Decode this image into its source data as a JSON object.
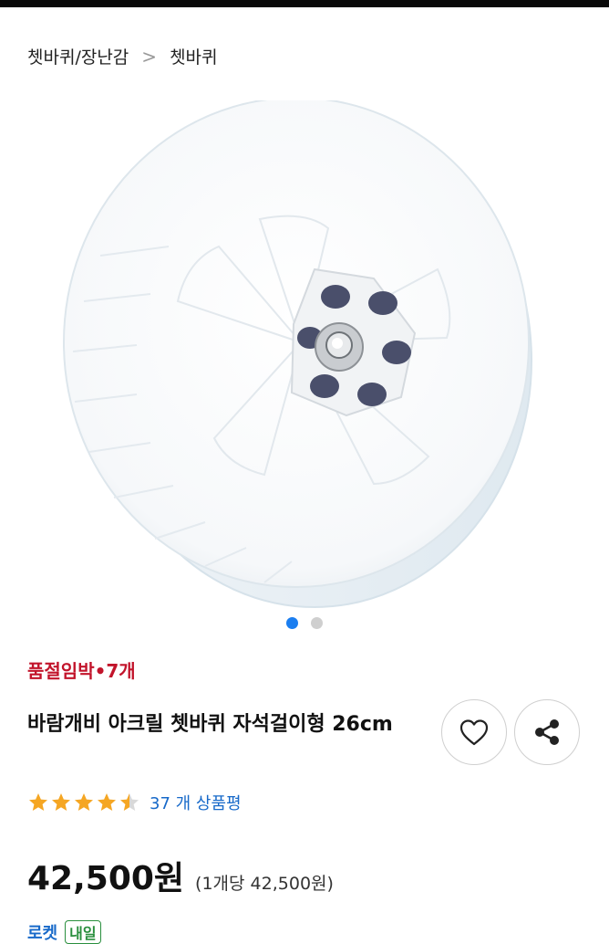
{
  "breadcrumb": {
    "parent": "쳇바퀴/장난감",
    "separator": ">",
    "current": "쳇바퀴"
  },
  "gallery": {
    "image_count": 2,
    "active_index": 0
  },
  "stock_badge": "품절임박•7개",
  "product": {
    "title": "바람개비 아크릴 쳇바퀴 자석걸이형 26cm",
    "rating": 4.5,
    "review_label": "37 개 상품평",
    "price": "42,500원",
    "unit_price": "(1개당 42,500원)"
  },
  "bottom": {
    "label": "로켓",
    "badge": "내일"
  },
  "colors": {
    "accent": "#1b7ef0",
    "stock": "#c2142b",
    "star": "#f5a623",
    "link": "#1769c9"
  }
}
